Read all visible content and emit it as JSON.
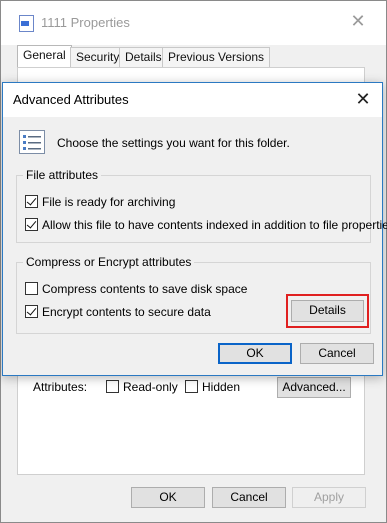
{
  "properties_window": {
    "title": "1111 Properties",
    "tabs": [
      {
        "label": "General",
        "active": true
      },
      {
        "label": "Security",
        "active": false
      },
      {
        "label": "Details",
        "active": false
      },
      {
        "label": "Previous Versions",
        "active": false
      }
    ],
    "attributes_label": "Attributes:",
    "read_only_label": "Read-only",
    "hidden_label": "Hidden",
    "advanced_button": "Advanced...",
    "ok_button": "OK",
    "cancel_button": "Cancel",
    "apply_button": "Apply"
  },
  "advanced_dialog": {
    "title": "Advanced Attributes",
    "intro": "Choose the settings you want for this folder.",
    "file_attributes": {
      "heading": "File attributes",
      "options": [
        {
          "label": "File is ready for archiving",
          "checked": true
        },
        {
          "label": "Allow this file to have contents indexed in addition to file properties",
          "checked": true
        }
      ]
    },
    "compress_encrypt": {
      "heading": "Compress or Encrypt attributes",
      "compress_label": "Compress contents to save disk space",
      "compress_checked": false,
      "encrypt_label": "Encrypt contents to secure data",
      "encrypt_checked": true,
      "details_button": "Details"
    },
    "ok_button": "OK",
    "cancel_button": "Cancel"
  },
  "colors": {
    "highlight_border": "#e02020",
    "accent": "#0a64c8"
  }
}
